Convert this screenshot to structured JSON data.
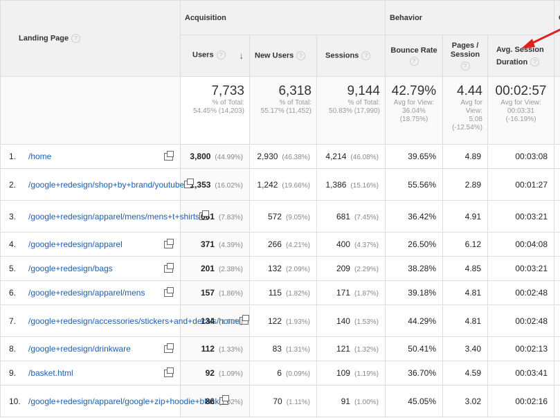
{
  "headers": {
    "landing_page": "Landing Page",
    "acquisition": "Acquisition",
    "behavior": "Behavior",
    "conversions_partial": "C",
    "users": "Users",
    "new_users": "New Users",
    "sessions": "Sessions",
    "bounce_rate": "Bounce Rate",
    "pages_session": "Pages / Session",
    "avg_session_duration": "Avg. Session Duration",
    "help": "?",
    "sort": "↓"
  },
  "totals": {
    "users": {
      "value": "7,733",
      "sub1": "% of Total:",
      "sub2": "54.45% (14,203)"
    },
    "new_users": {
      "value": "6,318",
      "sub1": "% of Total:",
      "sub2": "55.17% (11,452)"
    },
    "sessions": {
      "value": "9,144",
      "sub1": "% of Total:",
      "sub2": "50.83% (17,990)"
    },
    "bounce_rate": {
      "value": "42.79%",
      "sub1": "Avg for View:",
      "sub2": "36.04%",
      "sub3": "(18.75%)"
    },
    "pages_session": {
      "value": "4.44",
      "sub1": "Avg for",
      "sub2": "View:",
      "sub3": "5.08",
      "sub4": "(-12.54%)"
    },
    "avg_duration": {
      "value": "00:02:57",
      "sub1": "Avg for View:",
      "sub2": "00:03:31",
      "sub3": "(-16.19%)"
    }
  },
  "rows": [
    {
      "idx": "1.",
      "page": "/home",
      "users": "3,800",
      "users_pct": "(44.99%)",
      "new_users": "2,930",
      "new_users_pct": "(46.38%)",
      "sessions": "4,214",
      "sessions_pct": "(46.08%)",
      "bounce": "39.65%",
      "pages": "4.89",
      "duration": "00:03:08"
    },
    {
      "idx": "2.",
      "page": "/google+redesign/shop+by+brand/youtube",
      "users": "1,353",
      "users_pct": "(16.02%)",
      "new_users": "1,242",
      "new_users_pct": "(19.66%)",
      "sessions": "1,386",
      "sessions_pct": "(15.16%)",
      "bounce": "55.56%",
      "pages": "2.89",
      "duration": "00:01:27"
    },
    {
      "idx": "3.",
      "page": "/google+redesign/apparel/mens/mens+t+shirts",
      "users": "661",
      "users_pct": "(7.83%)",
      "new_users": "572",
      "new_users_pct": "(9.05%)",
      "sessions": "681",
      "sessions_pct": "(7.45%)",
      "bounce": "36.42%",
      "pages": "4.91",
      "duration": "00:03:21"
    },
    {
      "idx": "4.",
      "page": "/google+redesign/apparel",
      "users": "371",
      "users_pct": "(4.39%)",
      "new_users": "266",
      "new_users_pct": "(4.21%)",
      "sessions": "400",
      "sessions_pct": "(4.37%)",
      "bounce": "26.50%",
      "pages": "6.12",
      "duration": "00:04:08"
    },
    {
      "idx": "5.",
      "page": "/google+redesign/bags",
      "users": "201",
      "users_pct": "(2.38%)",
      "new_users": "132",
      "new_users_pct": "(2.09%)",
      "sessions": "209",
      "sessions_pct": "(2.29%)",
      "bounce": "38.28%",
      "pages": "4.85",
      "duration": "00:03:21"
    },
    {
      "idx": "6.",
      "page": "/google+redesign/apparel/mens",
      "users": "157",
      "users_pct": "(1.86%)",
      "new_users": "115",
      "new_users_pct": "(1.82%)",
      "sessions": "171",
      "sessions_pct": "(1.87%)",
      "bounce": "39.18%",
      "pages": "4.81",
      "duration": "00:02:48"
    },
    {
      "idx": "7.",
      "page": "/google+redesign/accessories/stickers+and+decals/home",
      "users": "134",
      "users_pct": "(1.59%)",
      "new_users": "122",
      "new_users_pct": "(1.93%)",
      "sessions": "140",
      "sessions_pct": "(1.53%)",
      "bounce": "44.29%",
      "pages": "4.81",
      "duration": "00:02:48"
    },
    {
      "idx": "8.",
      "page": "/google+redesign/drinkware",
      "users": "112",
      "users_pct": "(1.33%)",
      "new_users": "83",
      "new_users_pct": "(1.31%)",
      "sessions": "121",
      "sessions_pct": "(1.32%)",
      "bounce": "50.41%",
      "pages": "3.40",
      "duration": "00:02:13"
    },
    {
      "idx": "9.",
      "page": "/basket.html",
      "users": "92",
      "users_pct": "(1.09%)",
      "new_users": "6",
      "new_users_pct": "(0.09%)",
      "sessions": "109",
      "sessions_pct": "(1.19%)",
      "bounce": "36.70%",
      "pages": "4.59",
      "duration": "00:03:41"
    },
    {
      "idx": "10.",
      "page": "/google+redesign/apparel/google+zip+hoodie+black",
      "users": "86",
      "users_pct": "(1.02%)",
      "new_users": "70",
      "new_users_pct": "(1.11%)",
      "sessions": "91",
      "sessions_pct": "(1.00%)",
      "bounce": "45.05%",
      "pages": "3.02",
      "duration": "00:02:16"
    }
  ],
  "colors": {
    "link": "#1a5fb4",
    "header_bg": "#f1f1f1",
    "annotation_arrow": "#e02020"
  },
  "icons": {
    "external_link": "open-in-new-window-icon",
    "help": "help-circle-icon",
    "sort": "sort-down-arrow-icon",
    "annotation": "red-arrow-annotation"
  }
}
